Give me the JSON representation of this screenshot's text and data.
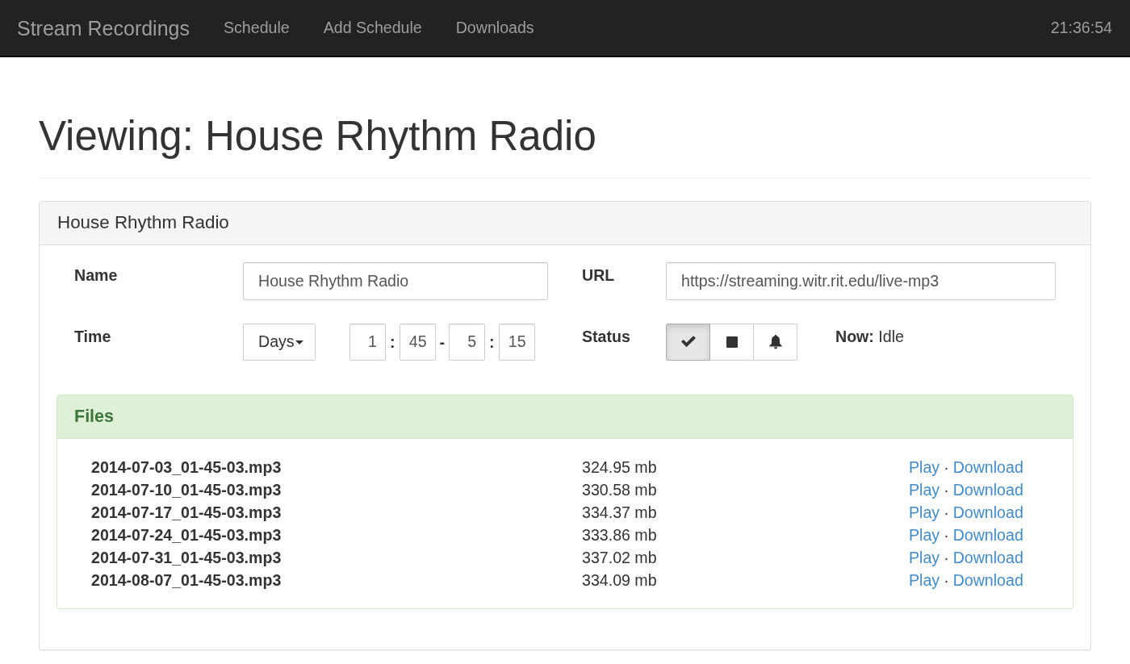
{
  "navbar": {
    "brand": "Stream Recordings",
    "links": [
      {
        "label": "Schedule",
        "selected": false
      },
      {
        "label": "Add Schedule",
        "selected": false
      },
      {
        "label": "Downloads",
        "selected": false
      }
    ],
    "clock": "21:36:54"
  },
  "page_title": "Viewing: House Rhythm Radio",
  "panel": {
    "title": "House Rhythm Radio",
    "form": {
      "name": {
        "label": "Name",
        "value": "House Rhythm Radio"
      },
      "url": {
        "label": "URL",
        "value": "https://streaming.witr.rit.edu/live-mp3"
      },
      "time": {
        "label": "Time",
        "mode": "Days",
        "parts": [
          {
            "kind": "field",
            "value": "1"
          },
          {
            "kind": "separator",
            "text": ":"
          },
          {
            "kind": "field",
            "value": "45"
          },
          {
            "kind": "separator",
            "text": "-"
          },
          {
            "kind": "field",
            "value": "5"
          },
          {
            "kind": "separator",
            "text": ":"
          },
          {
            "kind": "field",
            "value": "15"
          }
        ]
      },
      "status": {
        "label": "Status",
        "buttons": [
          {
            "kind": "check",
            "selected": true
          },
          {
            "kind": "stop",
            "selected": false
          },
          {
            "kind": "bell",
            "selected": false
          }
        ],
        "now": "**Now:** Idle"
      }
    },
    "files": {
      "title": "Files",
      "rows": [
        {
          "name": "2014-07-03_01-45-03.mp3",
          "size": "324.95 mb",
          "play": "Play",
          "separator": "·",
          "download": "Download"
        },
        {
          "name": "2014-07-10_01-45-03.mp3",
          "size": "330.58 mb",
          "play": "Play",
          "separator": "·",
          "download": "Download"
        },
        {
          "name": "2014-07-17_01-45-03.mp3",
          "size": "334.37 mb",
          "play": "Play",
          "separator": "·",
          "download": "Download"
        },
        {
          "name": "2014-07-24_01-45-03.mp3",
          "size": "333.86 mb",
          "play": "Play",
          "separator": "·",
          "download": "Download"
        },
        {
          "name": "2014-07-31_01-45-03.mp3",
          "size": "337.02 mb",
          "play": "Play",
          "separator": "·",
          "download": "Download"
        },
        {
          "name": "2014-08-07_01-45-03.mp3",
          "size": "334.09 mb",
          "play": "Play",
          "separator": "·",
          "download": "Download"
        }
      ]
    }
  }
}
